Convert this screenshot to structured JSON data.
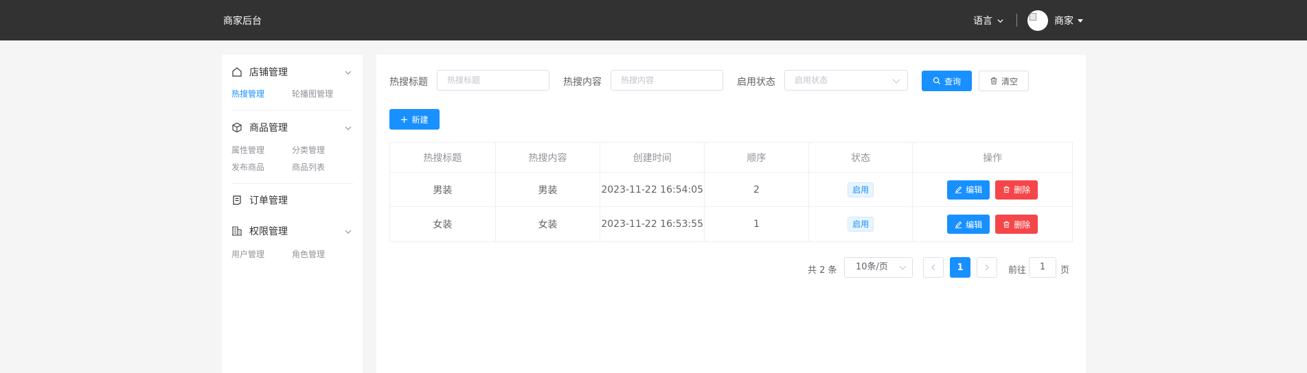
{
  "header": {
    "brand": "商家后台",
    "language_label": "语言",
    "user_name": "商家"
  },
  "sidebar": {
    "groups": [
      {
        "title": "店铺管理",
        "icon": "home-icon",
        "items": [
          "热搜管理",
          "轮播图管理"
        ],
        "active_item": "热搜管理",
        "expandable": true
      },
      {
        "title": "商品管理",
        "icon": "box-icon",
        "items": [
          "属性管理",
          "分类管理",
          "发布商品",
          "商品列表"
        ],
        "expandable": true
      },
      {
        "title": "订单管理",
        "icon": "document-icon",
        "items": [],
        "expandable": false
      },
      {
        "title": "权限管理",
        "icon": "building-icon",
        "items": [
          "用户管理",
          "角色管理"
        ],
        "expandable": true
      }
    ]
  },
  "filters": {
    "title_label": "热搜标题",
    "title_placeholder": "热搜标题",
    "content_label": "热搜内容",
    "content_placeholder": "热搜内容",
    "status_label": "启用状态",
    "status_placeholder": "启用状态",
    "search_button": "查询",
    "clear_button": "清空"
  },
  "toolbar": {
    "new_button": "新建"
  },
  "table": {
    "columns": [
      "热搜标题",
      "热搜内容",
      "创建时间",
      "顺序",
      "状态",
      "操作"
    ],
    "rows": [
      {
        "title": "男装",
        "content": "男装",
        "created": "2023-11-22 16:54:05",
        "order": "2",
        "status": "启用",
        "edit": "编辑",
        "delete": "删除"
      },
      {
        "title": "女装",
        "content": "女装",
        "created": "2023-11-22 16:53:55",
        "order": "1",
        "status": "启用",
        "edit": "编辑",
        "delete": "删除"
      }
    ]
  },
  "pagination": {
    "total_text": "共 2 条",
    "page_size": "10条/页",
    "current_page": "1",
    "goto_label": "前往",
    "goto_value": "1",
    "page_suffix": "页"
  },
  "colors": {
    "header_bg": "#323232",
    "primary": "#1890ff",
    "danger": "#f5464a"
  }
}
